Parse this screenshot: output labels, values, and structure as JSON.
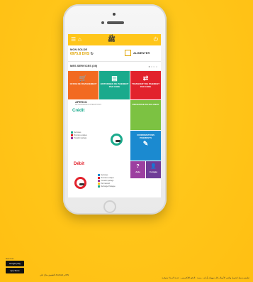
{
  "app": {
    "logo": "ﷺ",
    "balance_label": "MON SOLDE",
    "balance_amount": "6975.8 DHS",
    "balance_refresh_icon": "refresh-icon",
    "recharge_label": "ALIMENTER",
    "services_title": "MES SERVICES (39)",
    "pager": "●○○○"
  },
  "tiles": [
    {
      "label": "OFFRE DE FINANCEMENT",
      "icon": "basket-icon",
      "color": "#f26a21"
    },
    {
      "label": "HISTORIQUE DE PAIEMENT PAR CODE",
      "icon": "list-icon",
      "color": "#1aaa8c"
    },
    {
      "label": "TRANSFERT DE PAIEMENT PAR CODE",
      "icon": "transfer-icon",
      "color": "#e2222c"
    },
    {
      "label": "RECHARGE DE BALANCE",
      "icon": "wallet-icon",
      "color": "#7cc242"
    },
    {
      "label": "CONFIRMATIONS PAIEMENTS",
      "icon": "pen-icon",
      "color": "#1b8ad0"
    },
    {
      "label": "Aide",
      "icon": "question-icon",
      "color": "#9c3fa0"
    },
    {
      "label": "Compte",
      "icon": "user-icon",
      "color": "#6f3c97"
    }
  ],
  "overview": {
    "title": "APERCU",
    "subtitle": "DE DERNIERES OPERATIONS",
    "credit_label": "Crédit",
    "debit_label": "Débit",
    "credit_legend": [
      "Dernières",
      "Premières étapes",
      "Transfert partagé"
    ],
    "debit_legend": [
      "Dernières",
      "Premières étapes",
      "Transfert partagé",
      "Par transfert",
      "Recharge Partagée"
    ]
  },
  "footer": {
    "store_top_caption": "Get it on",
    "store_google": "Google play",
    "store_apple": "App Store",
    "mid_text": "التطبيق متاح على Android و iOS",
    "right_text": "تطبيق بسيط لتحويل وتلقي الأموال بكل سهولة وأمان - رصيد - الدفع الإلكتروني - خدمة الزبناء متوفرة"
  }
}
